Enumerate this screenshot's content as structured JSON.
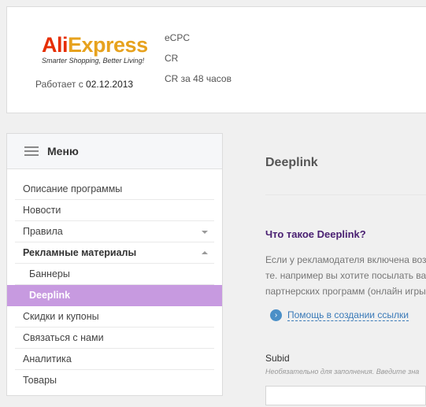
{
  "header": {
    "logo_primary": "Ali",
    "logo_secondary": "Express",
    "logo_tagline": "Smarter Shopping, Better Living!",
    "since_label": "Работает с",
    "since_date": "02.12.2013",
    "stats": [
      "eCPC",
      "CR",
      "CR за 48 часов"
    ]
  },
  "sidebar": {
    "title": "Меню",
    "items": [
      {
        "label": "Описание программы"
      },
      {
        "label": "Новости"
      },
      {
        "label": "Правила"
      },
      {
        "label": "Рекламные материалы"
      },
      {
        "label": "Баннеры"
      },
      {
        "label": "Deeplink"
      },
      {
        "label": "Скидки и купоны"
      },
      {
        "label": "Связаться с нами"
      },
      {
        "label": "Аналитика"
      },
      {
        "label": "Товары"
      }
    ]
  },
  "main": {
    "title": "Deeplink",
    "what_heading": "Что такое Deeplink?",
    "paragraph_lines": [
      "Если у рекламодателя включена воз",
      "те. например вы хотите посылать ва",
      "партнерских программ (онлайн игры"
    ],
    "help_link": "Помощь в создании ссылки",
    "subid_label": "Subid",
    "subid_hint": "Необязательно для заполнения. Введите зна",
    "subid_value": ""
  },
  "colors": {
    "active_item": "#c79ae0",
    "heading": "#4a2072",
    "link": "#3a7ab8"
  }
}
